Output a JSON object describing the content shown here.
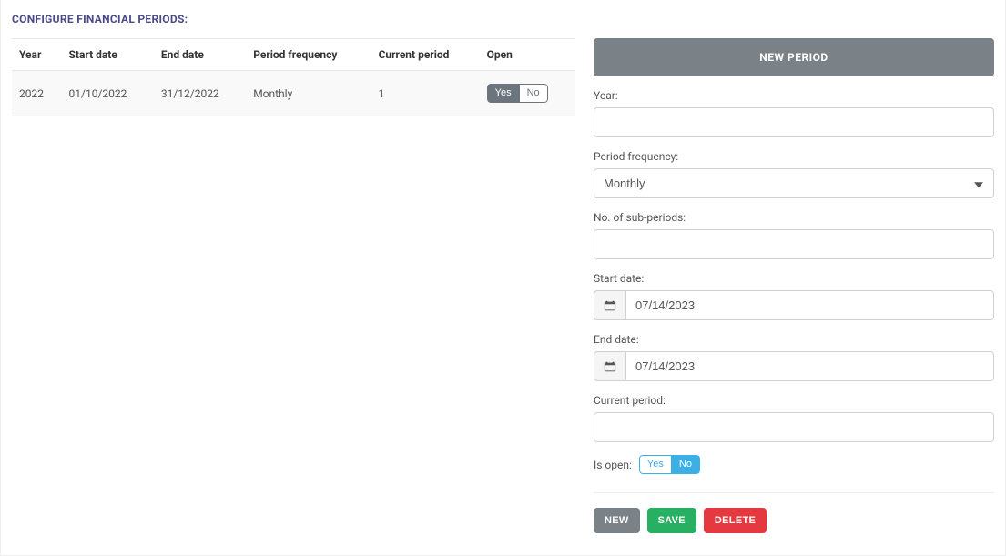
{
  "page_title": "CONFIGURE FINANCIAL PERIODS:",
  "table": {
    "headers": {
      "year": "Year",
      "start_date": "Start date",
      "end_date": "End date",
      "period_frequency": "Period frequency",
      "current_period": "Current period",
      "open": "Open"
    },
    "rows": [
      {
        "year": "2022",
        "start_date": "01/10/2022",
        "end_date": "31/12/2022",
        "period_frequency": "Monthly",
        "current_period": "1",
        "open_yes": "Yes",
        "open_no": "No"
      }
    ]
  },
  "panel": {
    "title": "NEW PERIOD",
    "labels": {
      "year": "Year:",
      "period_frequency": "Period frequency:",
      "sub_periods": "No. of sub-periods:",
      "start_date": "Start date:",
      "end_date": "End date:",
      "current_period": "Current period:",
      "is_open": "Is open:"
    },
    "values": {
      "year": "",
      "period_frequency_selected": "Monthly",
      "sub_periods": "",
      "start_date": "07/14/2023",
      "end_date": "07/14/2023",
      "current_period": ""
    },
    "is_open_yes": "Yes",
    "is_open_no": "No",
    "buttons": {
      "new": "NEW",
      "save": "SAVE",
      "delete": "DELETE"
    }
  },
  "icons": {
    "calendar": "calendar-icon"
  }
}
